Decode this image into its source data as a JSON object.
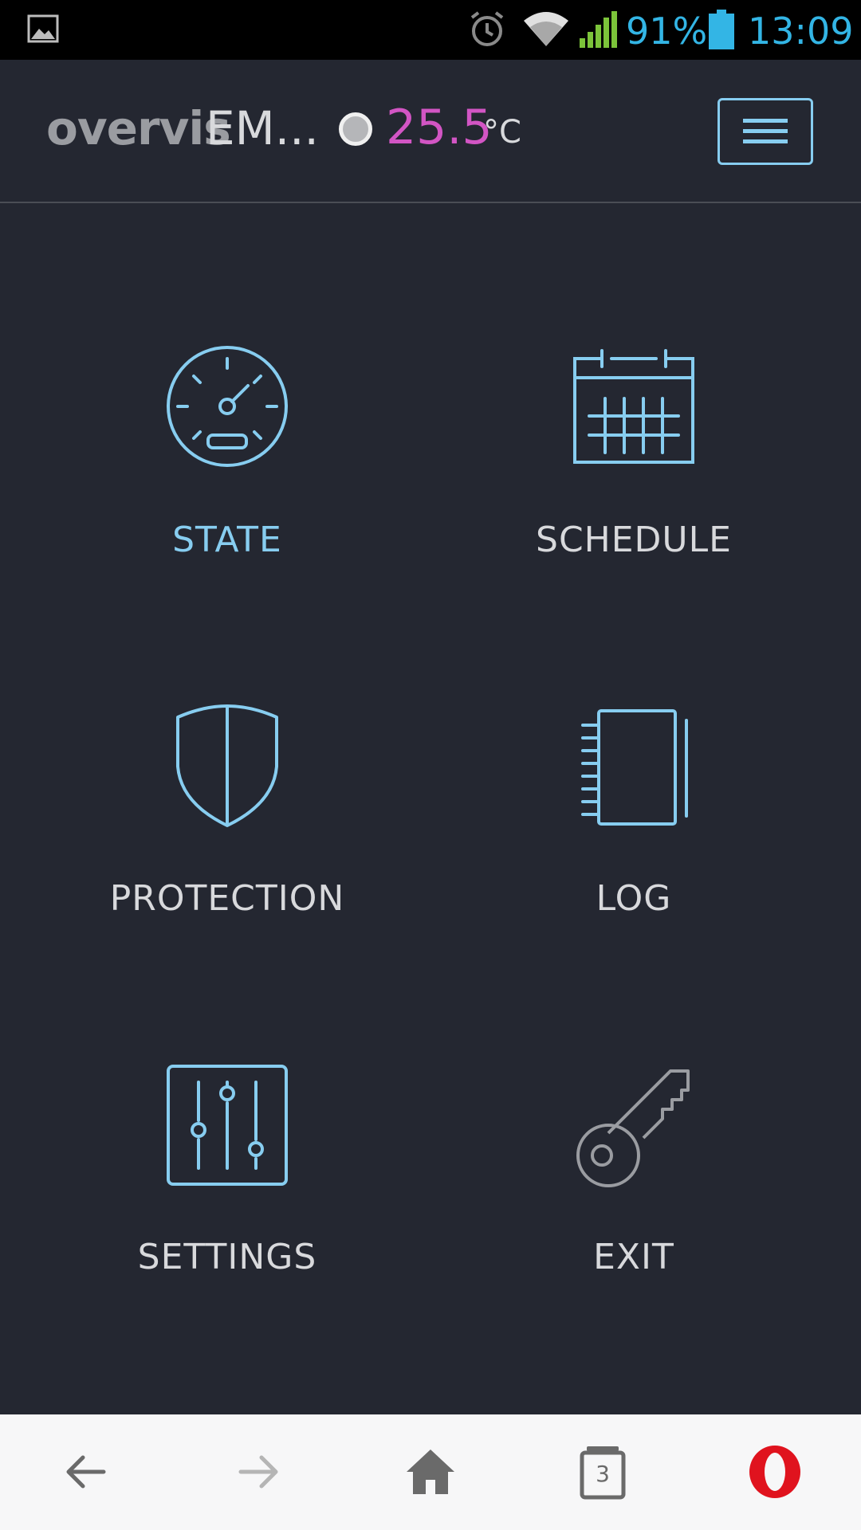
{
  "status_bar": {
    "battery_percent": "91%",
    "time": "13:09",
    "icons": [
      "gallery-icon",
      "alarm-icon",
      "wifi-icon",
      "signal-icon",
      "battery-icon"
    ],
    "accent_color": "#33b5e5"
  },
  "header": {
    "brand": "overvis",
    "device_name": "EM...",
    "temperature": "25.5",
    "temperature_unit": "°C",
    "temperature_color": "#d255c4",
    "menu_icon": "hamburger-icon"
  },
  "tiles": [
    {
      "label": "STATE",
      "icon": "gauge-icon",
      "active": true
    },
    {
      "label": "SCHEDULE",
      "icon": "calendar-icon",
      "active": false
    },
    {
      "label": "PROTECTION",
      "icon": "shield-icon",
      "active": false
    },
    {
      "label": "LOG",
      "icon": "notebook-icon",
      "active": false
    },
    {
      "label": "SETTINGS",
      "icon": "sliders-icon",
      "active": false
    },
    {
      "label": "EXIT",
      "icon": "key-icon",
      "active": false
    }
  ],
  "colors": {
    "background": "#242731",
    "icon_accent": "#87cdf0",
    "label": "#d8d9dc"
  },
  "browser_bar": {
    "tab_count": "3",
    "icons": [
      "back-arrow-icon",
      "forward-arrow-icon",
      "home-icon",
      "tabs-icon",
      "opera-icon"
    ]
  }
}
